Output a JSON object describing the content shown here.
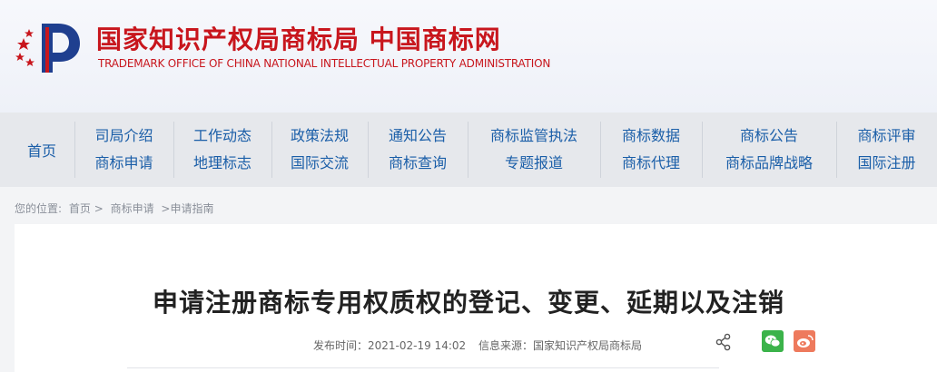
{
  "header": {
    "title_cn": "国家知识产权局商标局 中国商标网",
    "title_en": "TRADEMARK OFFICE OF CHINA NATIONAL INTELLECTUAL PROPERTY ADMINISTRATION"
  },
  "nav": {
    "home": "首页",
    "columns": [
      {
        "top": "司局介绍",
        "bottom": "商标申请"
      },
      {
        "top": "工作动态",
        "bottom": "地理标志"
      },
      {
        "top": "政策法规",
        "bottom": "国际交流"
      },
      {
        "top": "通知公告",
        "bottom": "商标查询"
      },
      {
        "top": "商标监管执法",
        "bottom": "专题报道"
      },
      {
        "top": "商标数据",
        "bottom": "商标代理"
      },
      {
        "top": "商标公告",
        "bottom": "商标品牌战略"
      },
      {
        "top": "商标评审",
        "bottom": "国际注册"
      }
    ]
  },
  "breadcrumb": {
    "label": "您的位置:",
    "items": [
      "首页 >",
      "商标申请",
      ">申请指南"
    ]
  },
  "article": {
    "title": "申请注册商标专用权质权的登记、变更、延期以及注销",
    "publish_time": "发布时间：2021-02-19 14:02",
    "source": "信息来源：国家知识产权局商标局"
  },
  "icons": {
    "share": "share-icon",
    "wechat": "wechat-icon",
    "weibo": "weibo-icon"
  },
  "colors": {
    "brand_red": "#c8161d",
    "nav_blue": "#1a5ea8",
    "wechat_green": "#3bb34a",
    "weibo_orange": "#ee7a5d"
  }
}
